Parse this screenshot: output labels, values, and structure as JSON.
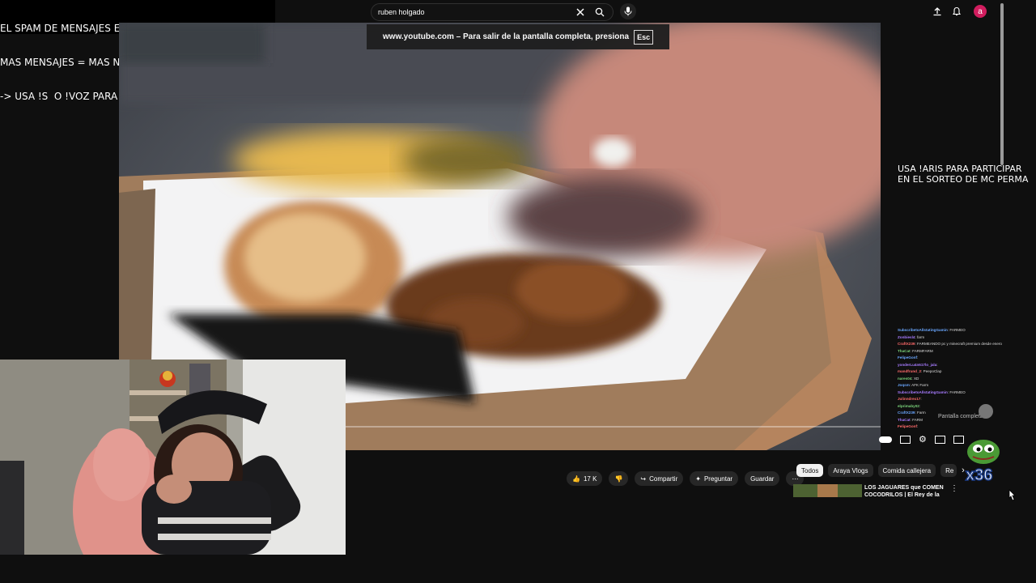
{
  "overlay": {
    "lines": [
      "EL SPAM DE MENSAJES ESTA PERMITIDO DE NUEVO",
      "MAS MENSAJES = MAS NIVEL = MEJORES RECOMPENSAS",
      "-> USA !S  O !VOZ PARA HABLAR EN EL CHAT"
    ]
  },
  "search": {
    "value": "ruben holgado",
    "clear_icon": "close-icon",
    "search_icon": "search-icon",
    "mic_icon": "mic-icon"
  },
  "header": {
    "avatar_letter": "a",
    "icons": [
      "upload-icon",
      "bell-icon"
    ]
  },
  "fullscreen_notice": {
    "text": "www.youtube.com – Para salir de la pantalla completa, presiona",
    "key": "Esc"
  },
  "actions": {
    "likes": "17 K",
    "share": "Compartir",
    "ask": "Preguntar",
    "save": "Guardar"
  },
  "chips": [
    "Todos",
    "Araya Vlogs",
    "Comida callejera",
    "Re"
  ],
  "recommendation": {
    "title": "LOS JAGUARES que COMEN COCODRILOS | El Rey de la"
  },
  "raffle": {
    "lines": [
      "USA !ARIS PARA PARTICIPAR",
      "EN EL SORTEO DE MC PERMA"
    ]
  },
  "chat": [
    {
      "user": "SubscribetoAllstatingGamin",
      "msg": "FARMEO"
    },
    {
      "user": "Zonbiesl4",
      "msg": "farm"
    },
    {
      "user": "CraftX239",
      "msg": "FARMEANDO pc y minecraft premium desde enero"
    },
    {
      "user": "ThaCat",
      "msg": "FARMFARM"
    },
    {
      "user": "FelipeGonf",
      "msg": ""
    },
    {
      "user": "yonderLu4n617lo_jala",
      "msg": ""
    },
    {
      "user": "mandfrund_2",
      "msg": "PeepoClap"
    },
    {
      "user": "nares04",
      "msg": "XD"
    },
    {
      "user": "Joqsm",
      "msg": "AFK Farm"
    },
    {
      "user": "SubscribetoAllstatingGamin",
      "msg": "FARMEO"
    },
    {
      "user": "Julinndrex17",
      "msg": ""
    },
    {
      "user": "elprimaby02",
      "msg": ""
    },
    {
      "user": "CraftX239",
      "msg": "Farm"
    },
    {
      "user": "ThaCat",
      "msg": "FARM"
    },
    {
      "user": "FelipeGonf",
      "msg": ""
    }
  ],
  "pantalla_label": "Pantalla completa",
  "multiplier": "x36",
  "colors": {
    "accent": "#d11d5e",
    "background": "#0f0f0f",
    "chip_active": "#f1f1f1"
  }
}
